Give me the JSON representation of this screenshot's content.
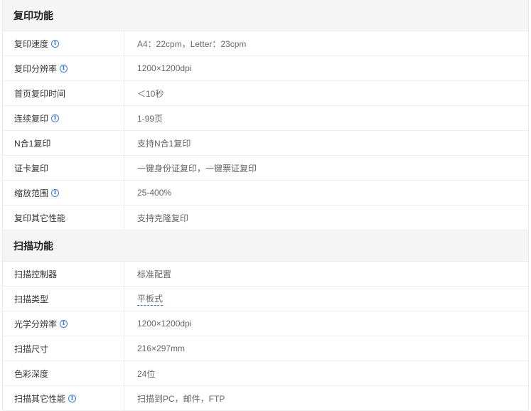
{
  "copy_section": {
    "title": "复印功能",
    "rows": [
      {
        "label": "复印速度",
        "value": "A4：22cpm，Letter：23cpm"
      },
      {
        "label": "复印分辨率",
        "value": "1200×1200dpi"
      },
      {
        "label": "首页复印时间",
        "value": "＜10秒"
      },
      {
        "label": "连续复印",
        "value": "1-99页"
      },
      {
        "label": "N合1复印",
        "value": "支持N合1复印"
      },
      {
        "label": "证卡复印",
        "value": "一键身份证复印，一键票证复印"
      },
      {
        "label": "缩放范围",
        "value": "25-400%"
      },
      {
        "label": "复印其它性能",
        "value": "支持克隆复印"
      }
    ]
  },
  "scan_section": {
    "title": "扫描功能",
    "rows": [
      {
        "label": "扫描控制器",
        "value": "标准配置"
      },
      {
        "label": "扫描类型",
        "value": "平板式"
      },
      {
        "label": "光学分辨率",
        "value": "1200×1200dpi"
      },
      {
        "label": "扫描尺寸",
        "value": "216×297mm"
      },
      {
        "label": "色彩深度",
        "value": "24位"
      },
      {
        "label": "扫描其它性能",
        "value": "扫描到PC，邮件，FTP"
      }
    ]
  },
  "info_icon_glyph": "i",
  "accent_color": "#3a7ae0"
}
